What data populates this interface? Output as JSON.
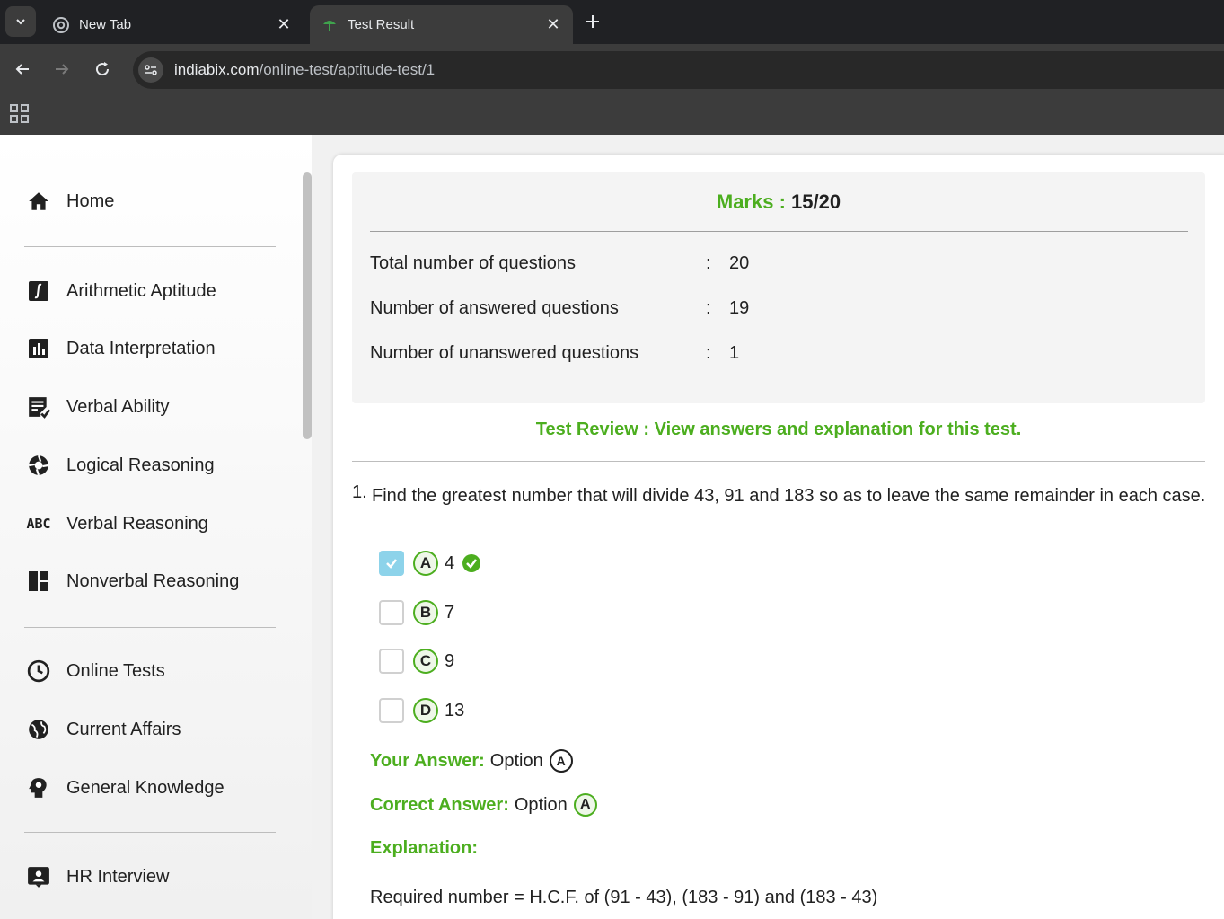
{
  "browser": {
    "tabs": [
      {
        "title": "New Tab",
        "active": false
      },
      {
        "title": "Test Result",
        "active": true
      }
    ],
    "url_host": "indiabix.com",
    "url_path": "/online-test/aptitude-test/1"
  },
  "sidebar": {
    "items": [
      {
        "label": "Home",
        "icon": "home-icon"
      },
      {
        "label": "Arithmetic Aptitude",
        "icon": "integral-icon"
      },
      {
        "label": "Data Interpretation",
        "icon": "bar-chart-icon"
      },
      {
        "label": "Verbal Ability",
        "icon": "doc-check-icon"
      },
      {
        "label": "Logical Reasoning",
        "icon": "aperture-icon"
      },
      {
        "label": "Verbal Reasoning",
        "icon": "abc-icon"
      },
      {
        "label": "Nonverbal Reasoning",
        "icon": "dashboard-icon"
      },
      {
        "label": "Online Tests",
        "icon": "clock-icon"
      },
      {
        "label": "Current Affairs",
        "icon": "globe-icon"
      },
      {
        "label": "General Knowledge",
        "icon": "bulb-head-icon"
      },
      {
        "label": "HR Interview",
        "icon": "contact-card-icon"
      }
    ]
  },
  "summary": {
    "marks_label": "Marks :",
    "marks_value": "15/20",
    "rows": [
      {
        "label": "Total number of questions",
        "sep": ":",
        "value": "20"
      },
      {
        "label": "Number of answered questions",
        "sep": ":",
        "value": "19"
      },
      {
        "label": "Number of unanswered questions",
        "sep": ":",
        "value": "1"
      }
    ]
  },
  "review_text": "Test Review : View answers and explanation for this test.",
  "question": {
    "number": "1.",
    "text": "Find the greatest number that will divide 43, 91 and 183 so as to leave the same remainder in each case.",
    "options": [
      {
        "letter": "A",
        "value": "4",
        "checked": true,
        "correct": true
      },
      {
        "letter": "B",
        "value": "7",
        "checked": false,
        "correct": false
      },
      {
        "letter": "C",
        "value": "9",
        "checked": false,
        "correct": false
      },
      {
        "letter": "D",
        "value": "13",
        "checked": false,
        "correct": false
      }
    ],
    "your_answer_label": "Your Answer:",
    "your_answer_text": "Option",
    "your_answer_letter": "A",
    "correct_answer_label": "Correct Answer:",
    "correct_answer_text": "Option",
    "correct_answer_letter": "A",
    "explanation_label": "Explanation:",
    "explanation_text": "Required number = H.C.F. of (91 - 43), (183 - 91) and (183 - 43)"
  },
  "colors": {
    "accent_green": "#4cae1f",
    "checked_blue": "#8dd3ea"
  }
}
